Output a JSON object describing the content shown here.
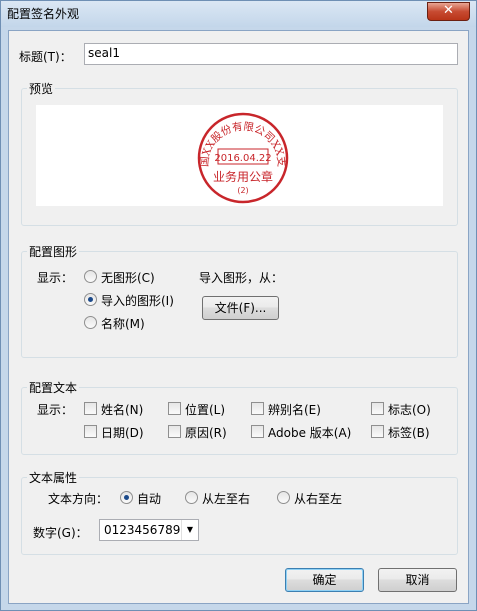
{
  "window": {
    "title": "配置签名外观",
    "close_symbol": "✕"
  },
  "title_field": {
    "label": "标题(T)：",
    "value": "seal1"
  },
  "preview": {
    "label": "预览",
    "seal": {
      "org_text": "中国XX股份有限公司XX支行",
      "date": "2016.04.22",
      "bottom_text": "业务用公章",
      "number": "(2)",
      "color": "#c8262b"
    }
  },
  "graphic": {
    "label": "配置图形",
    "display_label": "显示：",
    "options": [
      {
        "label": "无图形(C)",
        "checked": false
      },
      {
        "label": "导入的图形(I)",
        "checked": true
      },
      {
        "label": "名称(M)",
        "checked": false
      }
    ],
    "import_label": "导入图形，从：",
    "file_button": "文件(F)..."
  },
  "text": {
    "label": "配置文本",
    "display_label": "显示：",
    "checkboxes": [
      {
        "label": "姓名(N)",
        "checked": false
      },
      {
        "label": "位置(L)",
        "checked": false
      },
      {
        "label": "辨别名(E)",
        "checked": false
      },
      {
        "label": "标志(O)",
        "checked": false
      },
      {
        "label": "日期(D)",
        "checked": false
      },
      {
        "label": "原因(R)",
        "checked": false
      },
      {
        "label": "Adobe 版本(A)",
        "checked": false
      },
      {
        "label": "标签(B)",
        "checked": false
      }
    ]
  },
  "text_props": {
    "label": "文本属性",
    "direction_label": "文本方向：",
    "directions": [
      {
        "label": "自动",
        "checked": true
      },
      {
        "label": "从左至右",
        "checked": false
      },
      {
        "label": "从右至左",
        "checked": false
      }
    ],
    "digits_label": "数字(G)：",
    "digits_value": "0123456789"
  },
  "buttons": {
    "ok": "确定",
    "cancel": "取消"
  }
}
